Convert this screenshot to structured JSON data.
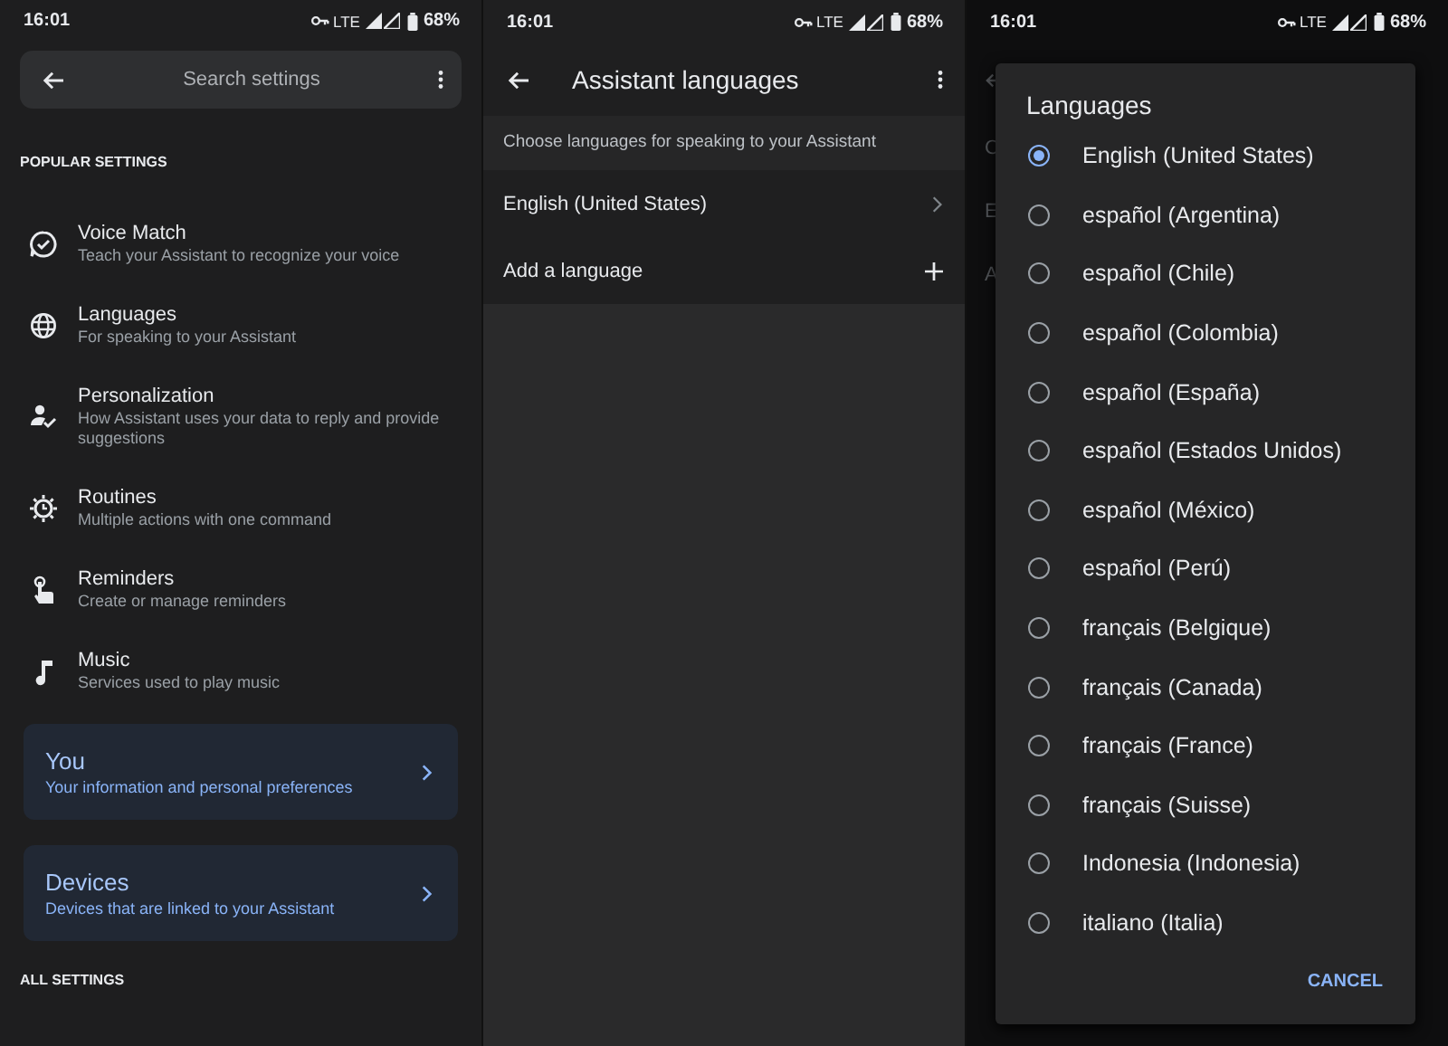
{
  "status_bars": [
    {
      "time": "16:01",
      "network": "LTE",
      "battery": "68%"
    },
    {
      "time": "16:01",
      "network": "LTE",
      "battery": "68%"
    },
    {
      "time": "16:01",
      "network": "LTE",
      "battery": "68%"
    }
  ],
  "settings_screen": {
    "search": {
      "placeholder": "Search settings"
    },
    "section_title": "POPULAR SETTINGS",
    "items": [
      {
        "kind": "voice",
        "title": "Voice Match",
        "subtitle": "Teach your Assistant to recognize your voice"
      },
      {
        "kind": "globe",
        "title": "Languages",
        "subtitle": "For speaking to your Assistant"
      },
      {
        "kind": "person",
        "title": "Personalization",
        "subtitle": "How Assistant uses your data to reply and provide suggestions"
      },
      {
        "kind": "routine",
        "title": "Routines",
        "subtitle": "Multiple actions with one command"
      },
      {
        "kind": "touch",
        "title": "Reminders",
        "subtitle": "Create or manage reminders"
      },
      {
        "kind": "music",
        "title": "Music",
        "subtitle": "Services used to play music"
      }
    ],
    "cards": [
      {
        "title": "You",
        "subtitle": "Your information and personal preferences"
      },
      {
        "title": "Devices",
        "subtitle": "Devices that are linked to your Assistant"
      }
    ],
    "next_section_title": "ALL SETTINGS"
  },
  "languages_screen": {
    "title": "Assistant languages",
    "description": "Choose languages for speaking to your Assistant",
    "rows": [
      {
        "kind": "link",
        "label": "English (United States)"
      },
      {
        "kind": "add",
        "label": "Add a language"
      }
    ]
  },
  "dialog_screen": {
    "behind_letters": [
      "C",
      "E",
      "A"
    ],
    "dialog": {
      "title": "Languages",
      "options": [
        {
          "label": "English (United States)",
          "selected": true
        },
        {
          "label": "español (Argentina)",
          "selected": false
        },
        {
          "label": "español (Chile)",
          "selected": false
        },
        {
          "label": "español (Colombia)",
          "selected": false
        },
        {
          "label": "español (España)",
          "selected": false
        },
        {
          "label": "español (Estados Unidos)",
          "selected": false
        },
        {
          "label": "español (México)",
          "selected": false
        },
        {
          "label": "español (Perú)",
          "selected": false
        },
        {
          "label": "français (Belgique)",
          "selected": false
        },
        {
          "label": "français (Canada)",
          "selected": false
        },
        {
          "label": "français (France)",
          "selected": false
        },
        {
          "label": "français (Suisse)",
          "selected": false
        },
        {
          "label": "Indonesia (Indonesia)",
          "selected": false
        },
        {
          "label": "italiano (Italia)",
          "selected": false
        }
      ],
      "cancel": "CANCEL"
    }
  }
}
